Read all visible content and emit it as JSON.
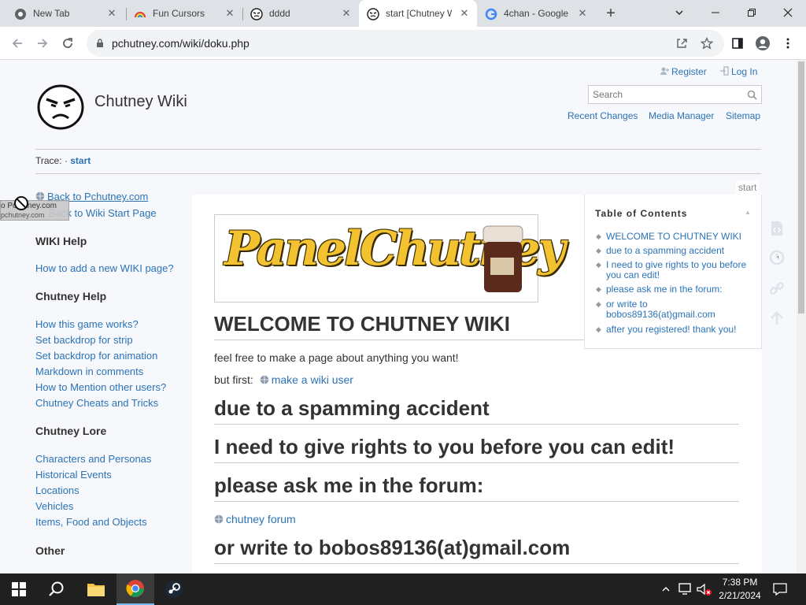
{
  "browser": {
    "tabs": [
      {
        "label": "New Tab",
        "icon": "chrome-icon"
      },
      {
        "label": "Fun Cursors",
        "icon": "rainbow-icon"
      },
      {
        "label": "dddd",
        "icon": "chutney-face-icon"
      },
      {
        "label": "start [Chutney W",
        "icon": "chutney-face-icon"
      },
      {
        "label": "4chan - Google",
        "icon": "google-icon"
      }
    ],
    "new_tab_symbol": "+",
    "url": "pchutney.com/wiki/doku.php"
  },
  "header": {
    "site_title": "Chutney Wiki",
    "register_label": "Register",
    "login_label": "Log In",
    "search_placeholder": "Search",
    "nav": [
      "Recent Changes",
      "Media Manager",
      "Sitemap"
    ]
  },
  "trace": {
    "label": "Trace:",
    "sep": "·",
    "item": "start"
  },
  "page_id": "start",
  "cursor_tooltip": {
    "line1": "o Pchutney.com",
    "line2": "pchutney.com"
  },
  "sidebar": {
    "top_links": [
      "Back to Pchutney.com",
      "Back to Wiki Start Page"
    ],
    "sections": [
      {
        "title": "WIKI Help",
        "items": [
          "How to add a new WIKI page?"
        ]
      },
      {
        "title": "Chutney Help",
        "items": [
          "How this game works?",
          "Set backdrop for strip",
          "Set backdrop for animation",
          "Markdown in comments",
          "How to Mention other users?",
          "Chutney Cheats and Tricks"
        ]
      },
      {
        "title": "Chutney Lore",
        "items": [
          "Characters and Personas",
          "Historical Events",
          "Locations",
          "Vehicles",
          "Items, Food and Objects"
        ]
      },
      {
        "title": "Other",
        "items": []
      }
    ]
  },
  "content": {
    "banner_text": "PanelChutney",
    "h1": "WELCOME TO CHUTNEY WIKI",
    "intro": "feel free to make a page about anything you want!",
    "but_first": "but first:",
    "make_user_link": "make a wiki user",
    "h2_spam": "due to a spamming accident",
    "h2_rights": "I need to give rights to you before you can edit!",
    "h2_forum": "please ask me in the forum:",
    "forum_link": "chutney forum",
    "h2_email": "or write to bobos89136(at)gmail.com"
  },
  "toc": {
    "title": "Table of Contents",
    "items": [
      "WELCOME TO CHUTNEY WIKI",
      "due to a spamming accident",
      "I need to give rights to you before you can edit!",
      "please ask me in the forum:",
      "or write to bobos89136(at)gmail.com",
      "after you registered! thank you!"
    ]
  },
  "taskbar": {
    "time": "7:38 PM",
    "date": "2/21/2024"
  },
  "colors": {
    "link": "#2b73b7",
    "page_bg": "#f6f8fb",
    "taskbar": "#202020",
    "tabstrip": "#dee1e6"
  }
}
